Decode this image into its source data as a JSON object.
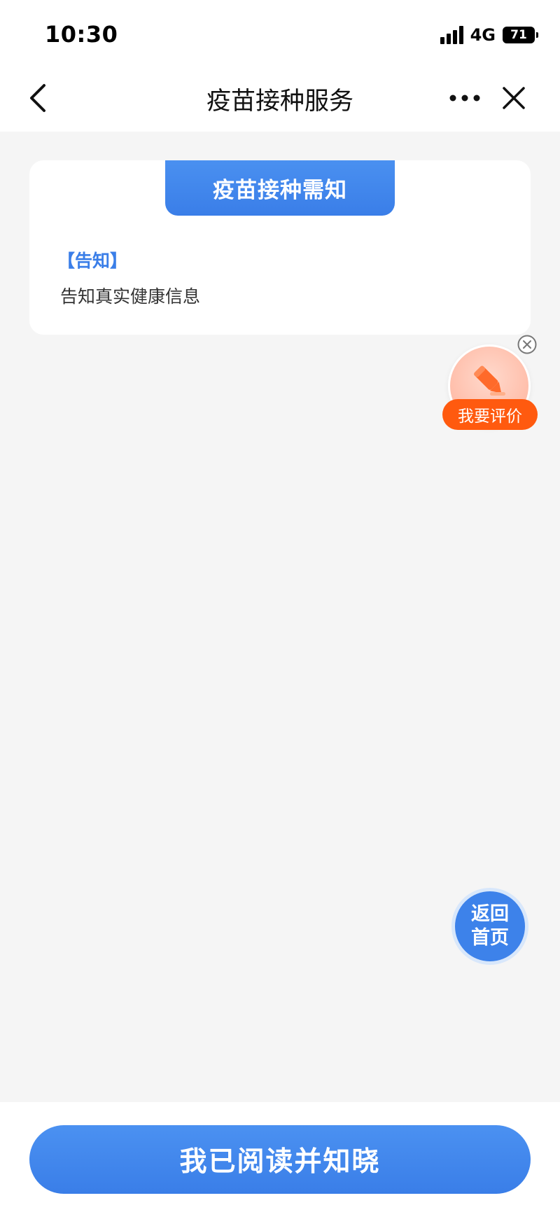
{
  "status_bar": {
    "time": "10:30",
    "network": "4G",
    "battery_level": "71"
  },
  "nav": {
    "title": "疫苗接种服务"
  },
  "notice_card": {
    "header": "疫苗接种需知",
    "section_title": "【告知】",
    "text": "告知真实健康信息"
  },
  "evaluate": {
    "label": "我要评价"
  },
  "back_home": {
    "line1": "返回",
    "line2": "首页"
  },
  "bottom": {
    "confirm_label": "我已阅读并知晓"
  },
  "colors": {
    "primary": "#3a7ee8",
    "evaluate_accent": "#ff5a0f",
    "page_background": "#f5f5f5"
  },
  "icons": {
    "back": "chevron-left-icon",
    "more": "more-dots-icon",
    "close": "close-icon",
    "evaluate": "pencil-icon",
    "evaluate_dismiss": "close-circle-icon"
  }
}
